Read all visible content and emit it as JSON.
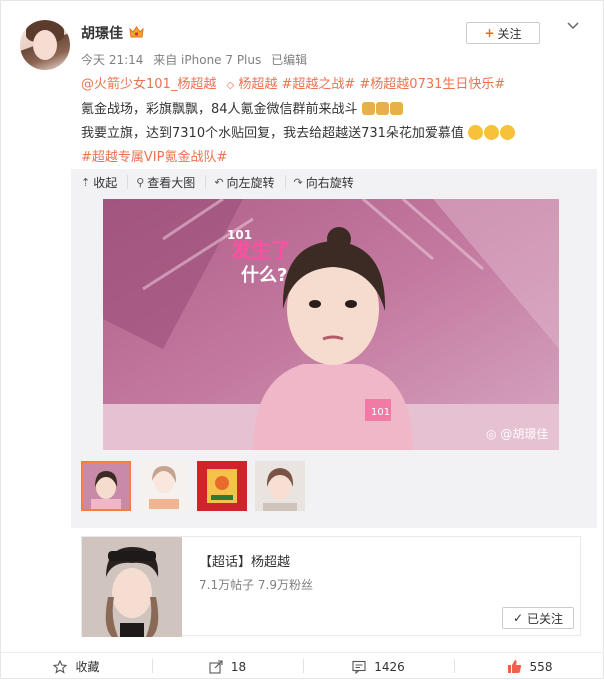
{
  "post": {
    "author": "胡璟佳",
    "time": "今天 21:14",
    "source": "来自 iPhone 7 Plus",
    "edited": "已编辑",
    "follow_label": "关注",
    "lines": {
      "tags_line": [
        "@火箭少女101_杨超越",
        "杨超越",
        "#超越之战#",
        "#杨超越0731生日快乐#"
      ],
      "line2": "氪金战场，彩旗飘飘，84人氪金微信群前来战斗",
      "line3": "我要立旗，达到7310个水贴回复，我去给超越送731朵花加爱慕值",
      "line4": "#超越专属VIP氪金战队#"
    }
  },
  "toolbar": {
    "collapse": "收起",
    "view_large": "查看大图",
    "rotate_left": "向左旋转",
    "rotate_right": "向右旋转"
  },
  "image": {
    "overlay_text_1": "101",
    "overlay_text_2": "发生了",
    "overlay_text_3": "什么?",
    "badge": "101",
    "watermark": "@胡璟佳"
  },
  "topic_card": {
    "title": "【超话】杨超越",
    "stats": "7.1万帖子 7.9万粉丝",
    "followed_label": "已关注"
  },
  "actions": {
    "favorite": "收藏",
    "repost": "18",
    "comment": "1426",
    "like": "558"
  },
  "colors": {
    "tag": "#eb7350",
    "accent": "#fa7d3c",
    "like": "#f0604d"
  }
}
